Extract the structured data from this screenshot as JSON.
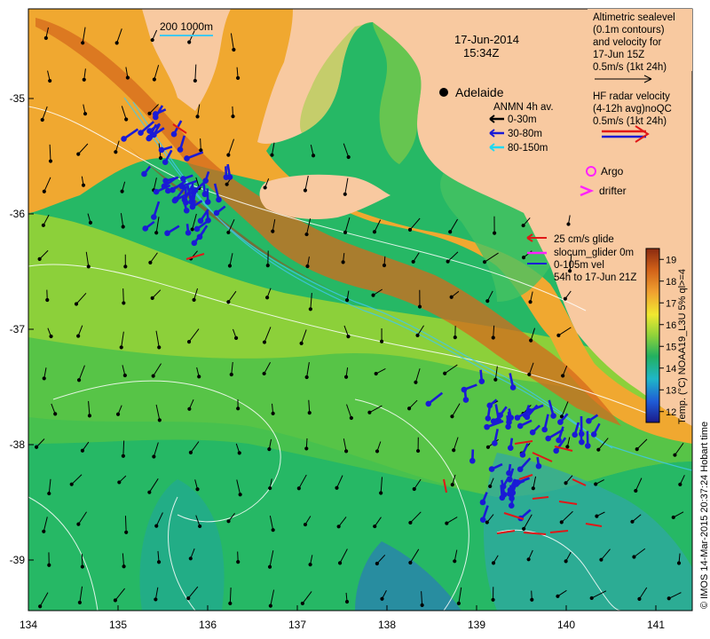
{
  "map": {
    "date": "17-Jun-2014",
    "time": "15:34Z",
    "city": "Adelaide",
    "scale_label": "200  1000m",
    "longitude_ticks": [
      "134",
      "135",
      "136",
      "137",
      "138",
      "139",
      "140",
      "141"
    ],
    "latitude_ticks": [
      "-35",
      "-36",
      "-37",
      "-38",
      "-39"
    ]
  },
  "legend": {
    "altimetric_lines": [
      "Altimetric sealevel",
      "(0.1m contours)",
      "and velocity for",
      "17-Jun 15Z",
      "0.5m/s (1kt 24h)"
    ],
    "hf_lines": [
      "HF radar velocity",
      "(4-12h avg)noQC",
      "0.5m/s (1kt 24h)"
    ],
    "anmn_title": "ANMN 4h av.",
    "anmn_items": [
      {
        "label": "0-30m",
        "color": "#000000"
      },
      {
        "label": "30-80m",
        "color": "#1a1ad6"
      },
      {
        "label": "80-150m",
        "color": "#22d8f0"
      }
    ],
    "argo_label": "Argo",
    "drifter_label": "drifter",
    "glider_lines": [
      "25 cm/s glide",
      "slocum_glider 0m",
      "0-105m vel",
      "54h to 17-Jun 21Z"
    ]
  },
  "colorbar": {
    "label": "Temp. (°C) NOAA19_L3U 5% ql>=4",
    "ticks": [
      "19",
      "18",
      "17",
      "16",
      "15",
      "14",
      "13",
      "12"
    ],
    "range": [
      11.5,
      19.5
    ]
  },
  "credit": "© IMOS 14-Mar-2015 20:37:24 Hobart time",
  "colors": {
    "land": "#f8c9a0",
    "warm_sst": "#e08a2a",
    "cool_sst": "#22b060",
    "hf_radar": "#e01818",
    "glider": "#d01010",
    "anmn_30_80": "#1a1ad6",
    "argo": "#ff22ff",
    "drifter": "#ff22ff"
  }
}
